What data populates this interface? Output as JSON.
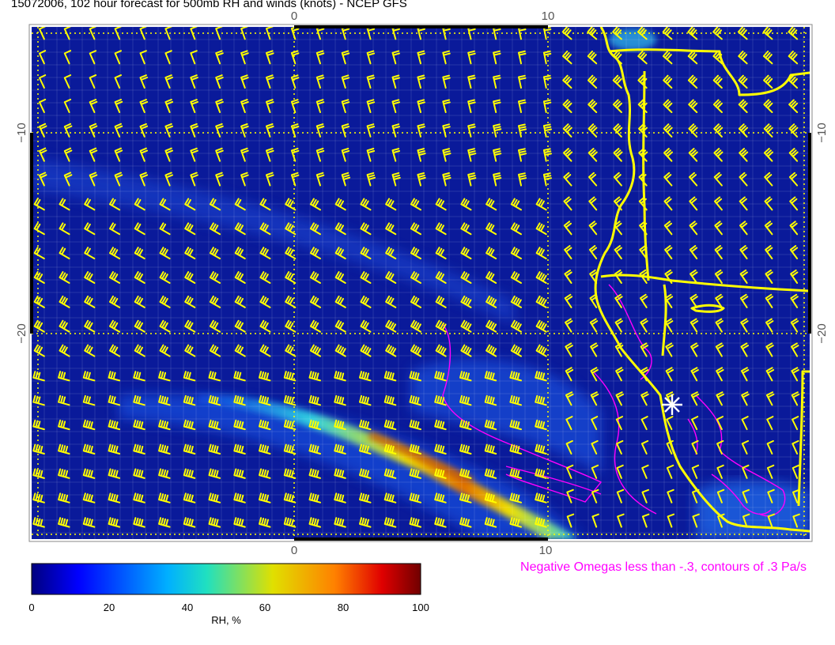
{
  "title": "15072006, 102 hour forecast for 500mb RH and winds (knots) - NCEP GFS",
  "axes": {
    "top_ticks": [
      "0",
      "10"
    ],
    "bottom_ticks": [
      "0",
      "10"
    ],
    "left_ticks": [
      "−10",
      "−20"
    ],
    "right_ticks": [
      "−10",
      "−20"
    ]
  },
  "omega_note": "Negative Omegas less than -.3, contours of .3 Pa/s",
  "colorbar": {
    "label": "RH, %",
    "ticks": [
      "0",
      "20",
      "40",
      "60",
      "80",
      "100"
    ],
    "min": 0,
    "max": 100
  },
  "colors": {
    "wind_barbs": "#ffff00",
    "coastline": "#ffff00",
    "omega_contours": "#ff00ff",
    "dry": "#00008b",
    "moist": "#800000"
  },
  "markers": [
    {
      "name": "station-star-icon"
    }
  ]
}
